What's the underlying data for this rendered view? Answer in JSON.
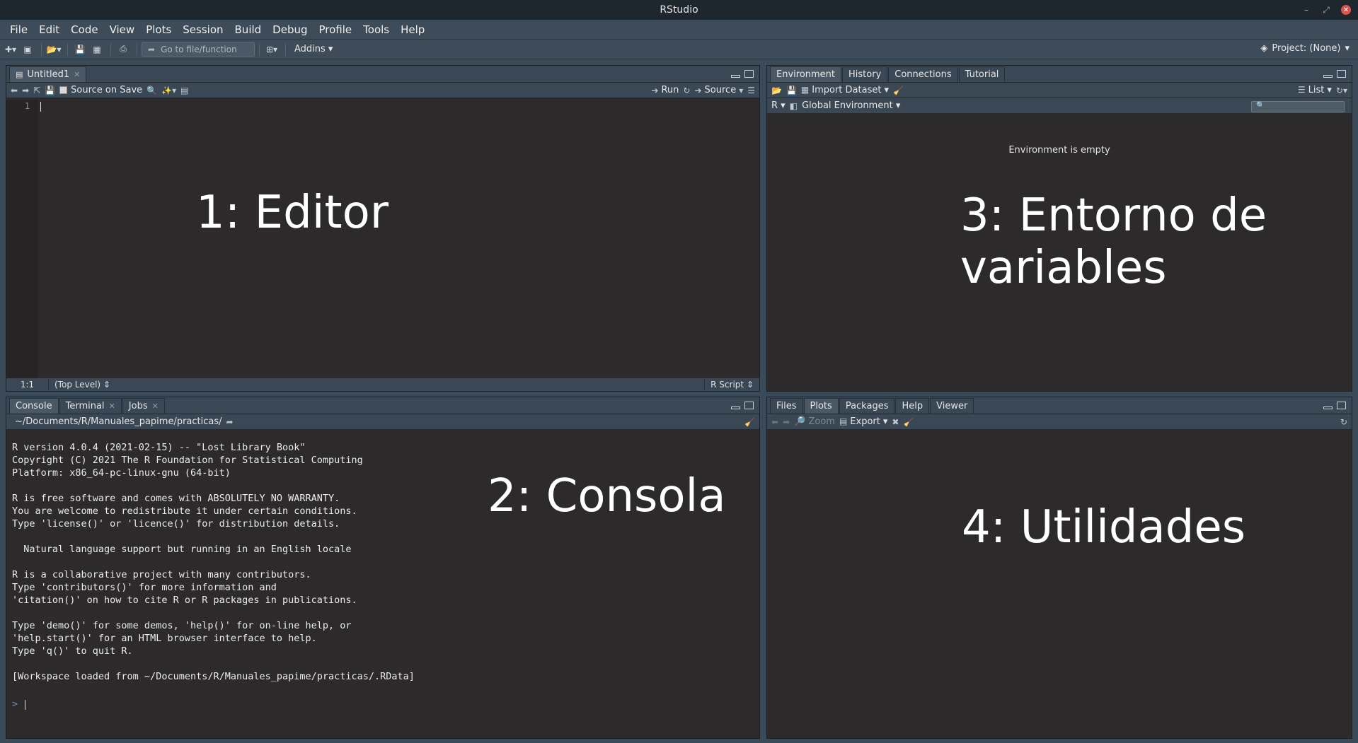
{
  "window": {
    "title": "RStudio"
  },
  "menubar": {
    "items": [
      {
        "label": "File"
      },
      {
        "label": "Edit"
      },
      {
        "label": "Code"
      },
      {
        "label": "View"
      },
      {
        "label": "Plots"
      },
      {
        "label": "Session"
      },
      {
        "label": "Build"
      },
      {
        "label": "Debug"
      },
      {
        "label": "Profile"
      },
      {
        "label": "Tools"
      },
      {
        "label": "Help"
      }
    ]
  },
  "toolbar": {
    "goto_placeholder": "Go to file/function",
    "addins_label": "Addins",
    "project_label": "Project: (None)"
  },
  "editor": {
    "tab_label": "Untitled1",
    "source_on_save": "Source on Save",
    "run_label": "Run",
    "source_label": "Source",
    "line_number": "1",
    "cursor_pos": "1:1",
    "level": "(Top Level)",
    "file_type": "R Script",
    "overlay_label": "1: Editor"
  },
  "console": {
    "tabs": [
      {
        "label": "Console"
      },
      {
        "label": "Terminal"
      },
      {
        "label": "Jobs"
      }
    ],
    "path": "~/Documents/R/Manuales_papime/practicas/",
    "output": "R version 4.0.4 (2021-02-15) -- \"Lost Library Book\"\nCopyright (C) 2021 The R Foundation for Statistical Computing\nPlatform: x86_64-pc-linux-gnu (64-bit)\n\nR is free software and comes with ABSOLUTELY NO WARRANTY.\nYou are welcome to redistribute it under certain conditions.\nType 'license()' or 'licence()' for distribution details.\n\n  Natural language support but running in an English locale\n\nR is a collaborative project with many contributors.\nType 'contributors()' for more information and\n'citation()' on how to cite R or R packages in publications.\n\nType 'demo()' for some demos, 'help()' for on-line help, or\n'help.start()' for an HTML browser interface to help.\nType 'q()' to quit R.\n\n[Workspace loaded from ~/Documents/R/Manuales_papime/practicas/.RData]",
    "prompt": ">",
    "overlay_label": "2: Consola"
  },
  "environment": {
    "tabs": [
      {
        "label": "Environment"
      },
      {
        "label": "History"
      },
      {
        "label": "Connections"
      },
      {
        "label": "Tutorial"
      }
    ],
    "import_dataset": "Import Dataset",
    "view_mode": "List",
    "language": "R",
    "scope": "Global Environment",
    "empty_message": "Environment is empty",
    "overlay_label": "3: Entorno de variables"
  },
  "utilities": {
    "tabs": [
      {
        "label": "Files"
      },
      {
        "label": "Plots"
      },
      {
        "label": "Packages"
      },
      {
        "label": "Help"
      },
      {
        "label": "Viewer"
      }
    ],
    "zoom_label": "Zoom",
    "export_label": "Export",
    "overlay_label": "4: Utilidades"
  },
  "colors": {
    "chrome_bg": "#3b4a58",
    "pane_bg": "#2c2a2a",
    "prompt": "#6f8fb5"
  }
}
